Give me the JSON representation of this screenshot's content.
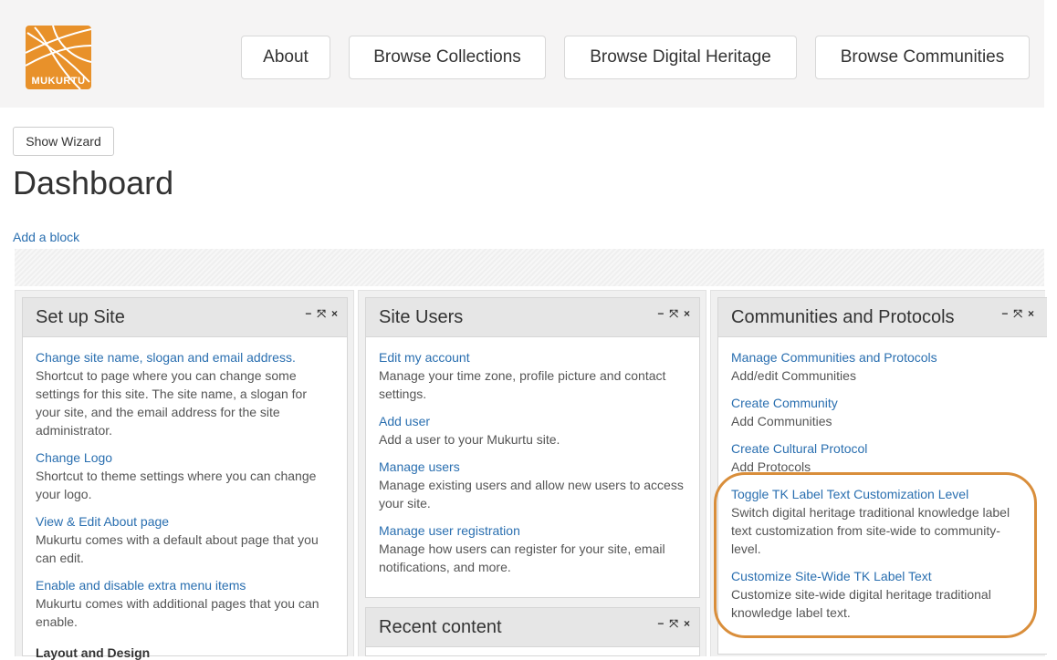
{
  "header": {
    "logo_text": "MUKURTU",
    "nav": [
      {
        "label": "About"
      },
      {
        "label": "Browse Collections"
      },
      {
        "label": "Browse Digital Heritage"
      },
      {
        "label": "Browse Communities"
      }
    ]
  },
  "wizard_button": "Show Wizard",
  "page_title": "Dashboard",
  "add_block": "Add a block",
  "panel_controls": {
    "minimize": "−",
    "expand": "⤧",
    "close": "×"
  },
  "panels": {
    "setup": {
      "title": "Set up Site",
      "items": [
        {
          "link": "Change site name, slogan and email address.",
          "desc": "Shortcut to page where you can change some settings for this site. The site name, a slogan for your site, and the email address for the site administrator."
        },
        {
          "link": "Change Logo",
          "desc": "Shortcut to theme settings where you can change your logo."
        },
        {
          "link": "View & Edit About page",
          "desc": "Mukurtu comes with a default about page that you can edit."
        },
        {
          "link": "Enable and disable extra menu items",
          "desc": "Mukurtu comes with additional pages that you can enable."
        }
      ],
      "section": "Layout and Design"
    },
    "users": {
      "title": "Site Users",
      "items": [
        {
          "link": "Edit my account",
          "desc": "Manage your time zone, profile picture and contact settings."
        },
        {
          "link": "Add user",
          "desc": "Add a user to your Mukurtu site."
        },
        {
          "link": "Manage users",
          "desc": "Manage existing users and allow new users to access your site."
        },
        {
          "link": "Manage user registration",
          "desc": "Manage how users can register for your site, email notifications, and more."
        }
      ]
    },
    "recent": {
      "title": "Recent content"
    },
    "communities": {
      "title": "Communities and Protocols",
      "items": [
        {
          "link": "Manage Communities and Protocols",
          "desc": "Add/edit Communities"
        },
        {
          "link": "Create Community",
          "desc": "Add Communities"
        },
        {
          "link": "Create Cultural Protocol",
          "desc": "Add Protocols"
        },
        {
          "link": "Toggle TK Label Text Customization Level",
          "desc": "Switch digital heritage traditional knowledge label text customization from site-wide to community-level."
        },
        {
          "link": "Customize Site-Wide TK Label Text",
          "desc": "Customize site-wide digital heritage traditional knowledge label text."
        }
      ]
    }
  },
  "colors": {
    "accent": "#e8912a",
    "link": "#2a6fb0",
    "highlight": "#d98e3b"
  }
}
